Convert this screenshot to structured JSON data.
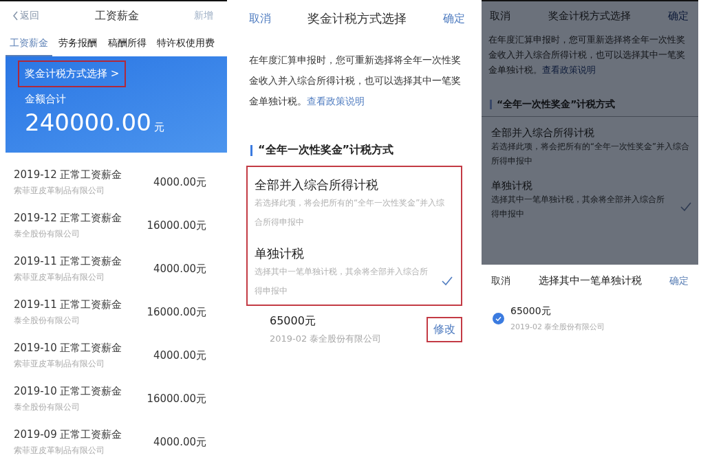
{
  "salary_screen": {
    "nav": {
      "back": "返回",
      "title": "工资薪金",
      "action": "新增"
    },
    "tabs": [
      {
        "label": "工资薪金",
        "selected": true
      },
      {
        "label": "劳务报酬",
        "selected": false
      },
      {
        "label": "稿酬所得",
        "selected": false
      },
      {
        "label": "特许权使用费",
        "selected": false
      }
    ],
    "banner": {
      "link": "奖金计税方式选择 >",
      "highlighted": true,
      "total_label": "金额合计",
      "total": "240000.00",
      "unit": "元"
    },
    "records": [
      {
        "title": "2019-12 正常工资薪金",
        "company": "索菲亚皮革制品有限公司",
        "amount": "4000.00元"
      },
      {
        "title": "2019-12 正常工资薪金",
        "company": "泰全股份有限公司",
        "amount": "16000.00元"
      },
      {
        "title": "2019-11 正常工资薪金",
        "company": "索菲亚皮革制品有限公司",
        "amount": "4000.00元"
      },
      {
        "title": "2019-11 正常工资薪金",
        "company": "泰全股份有限公司",
        "amount": "16000.00元"
      },
      {
        "title": "2019-10 正常工资薪金",
        "company": "索菲亚皮革制品有限公司",
        "amount": "4000.00元"
      },
      {
        "title": "2019-10 正常工资薪金",
        "company": "泰全股份有限公司",
        "amount": "16000.00元"
      },
      {
        "title": "2019-09 正常工资薪金",
        "company": "索菲亚皮革制品有限公司",
        "amount": "4000.00元"
      }
    ]
  },
  "method_screen": {
    "nav": {
      "cancel": "取消",
      "title": "奖金计税方式选择",
      "confirm": "确定"
    },
    "intro": {
      "text": "在年度汇算申报时，您可重新选择将全年一次性奖金收入并入综合所得计税，也可以选择其中一笔奖金单独计税。",
      "link": "查看政策说明"
    },
    "section_title": "“全年一次性奖金”计税方式",
    "options_highlighted": true,
    "options": [
      {
        "title": "全部并入综合所得计税",
        "description": "若选择此项，将会把所有的“全年一次性奖金”并入综合所得申报中",
        "selected": false
      },
      {
        "title": "单独计税",
        "description": "选择其中一笔单独计税，其余将全部并入综合所得申报中",
        "selected": true
      }
    ],
    "bonus": {
      "amount": "65000元",
      "detail": "2019-02 泰全股份有限公司",
      "action": "修改",
      "action_highlighted": true
    }
  },
  "picker_screen": {
    "nav": {
      "cancel": "取消",
      "title": "奖金计税方式选择",
      "confirm": "确定"
    },
    "intro": {
      "text": "在年度汇算申报时，您可重新选择将全年一次性奖金收入并入综合所得计税，也可以选择其中一笔奖金单独计税。",
      "link": "查看政策说明"
    },
    "section_title": "“全年一次性奖金”计税方式",
    "options": [
      {
        "title": "全部并入综合所得计税",
        "description": "若选择此项，将会把所有的“全年一次性奖金”并入综合所得申报中",
        "selected": false
      },
      {
        "title": "单独计税",
        "description": "选择其中一笔单独计税，其余将全部并入综合所得申报中",
        "selected": true
      }
    ],
    "sheet": {
      "cancel": "取消",
      "title": "选择其中一笔单独计税",
      "confirm": "确定",
      "items": [
        {
          "amount": "65000元",
          "detail": "2019-02 泰全股份有限公司",
          "checked": true
        }
      ]
    }
  }
}
